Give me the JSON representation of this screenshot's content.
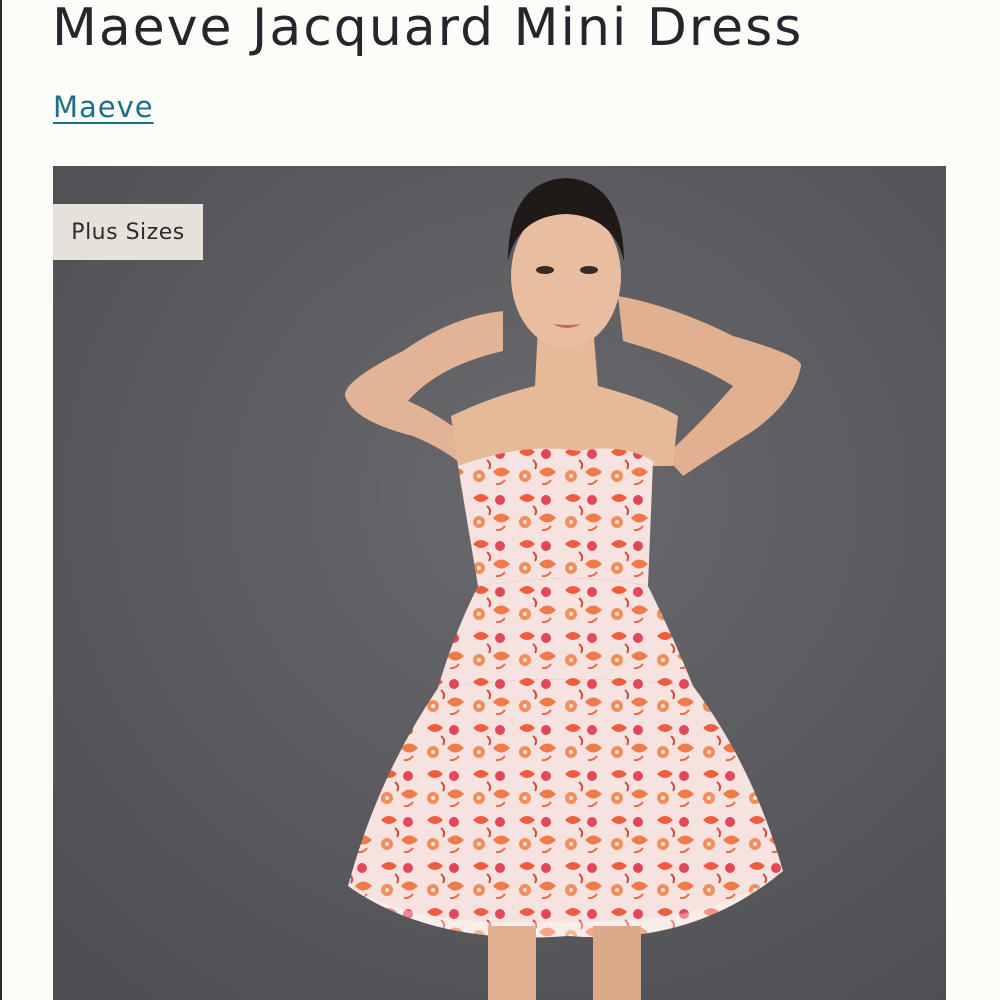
{
  "product": {
    "title": "Maeve Jacquard Mini Dress",
    "brand": "Maeve",
    "badge": "Plus Sizes"
  },
  "colors": {
    "page_background": "#fcfcf9",
    "title_text": "#24262b",
    "brand_link": "#1d6f8a",
    "photo_background": "#59595d",
    "badge_background": "#e6e2da",
    "dress_base": "#f7e4e0",
    "dress_pattern": "#ee5a3c"
  },
  "icons": {
    "product_photo": "model-in-floral-strapless-mini-dress"
  }
}
